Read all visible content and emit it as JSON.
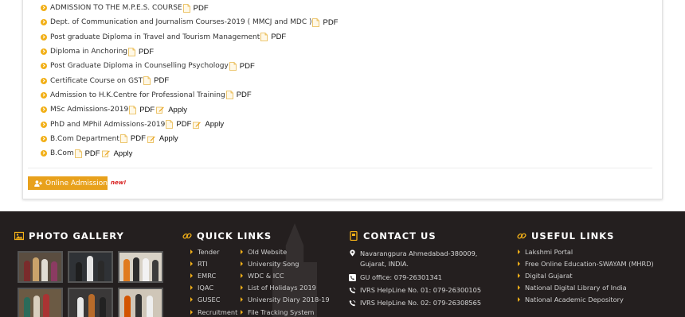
{
  "admissions": {
    "items": [
      {
        "text": "ADMISSION TO THE M.P.E.S. COURSE",
        "pdf": "PDF",
        "apply": ""
      },
      {
        "text": "Dept. of Communication and Journalism Courses-2019 ( MMCJ and MDC )",
        "pdf": "PDF",
        "apply": ""
      },
      {
        "text": "Post graduate Diploma in Travel and Tourism Management",
        "pdf": "PDF",
        "apply": ""
      },
      {
        "text": "Diploma in Anchoring",
        "pdf": "PDF",
        "apply": ""
      },
      {
        "text": "Post Graduate Diploma in Counselling Psychology",
        "pdf": "PDF",
        "apply": ""
      },
      {
        "text": "Certificate Course on GST",
        "pdf": "PDF",
        "apply": ""
      },
      {
        "text": "Admission to H.K.Centre for Professional Training",
        "pdf": "PDF",
        "apply": ""
      },
      {
        "text": "MSc Admissions-2019",
        "pdf": "PDF",
        "apply": "Apply"
      },
      {
        "text": "PhD and MPhil Admissions-2019",
        "pdf": "PDF",
        "apply": "Apply"
      },
      {
        "text": "B.Com Department",
        "pdf": "PDF",
        "apply": "Apply"
      },
      {
        "text": "B.Com",
        "pdf": "PDF",
        "apply": "Apply"
      }
    ],
    "online_admission_label": "Online Admission",
    "new_badge": "new!"
  },
  "footer": {
    "photo_gallery_title": "PHOTO GALLERY",
    "quick_links_title": "QUICK LINKS",
    "quick_links_col1": [
      "Tender",
      "RTI",
      "EMRC",
      "IQAC",
      "GUSEC",
      "Recruitment"
    ],
    "quick_links_col2": [
      "Old Website",
      "University Song",
      "WDC & ICC",
      "List of Holidays 2019",
      "University Diary 2018-19",
      "File Tracking System"
    ],
    "contact_title": "CONTACT US",
    "contact": {
      "address_line1": "Navarangpura Ahmedabad-380009,",
      "address_line2": "Gujarat, INDIA.",
      "office": "GU office:  079-26301341",
      "helpline1": "IVRS HelpLine No. 01: 079-26300105",
      "helpline2": "IVRS HelpLine No. 02: 079-26308565"
    },
    "useful_links_title": "USEFUL LINKS",
    "useful_links": [
      "Lakshmi Portal",
      "Free Online Education-SWAYAM (MHRD)",
      "Digital Gujarat",
      "National Digital Library of India",
      "National Academic Depository"
    ]
  },
  "colors": {
    "accent": "#f2b018",
    "button": "#e8a11c",
    "footer_bg": "#241f1f",
    "new_badge": "#d81b1b"
  }
}
